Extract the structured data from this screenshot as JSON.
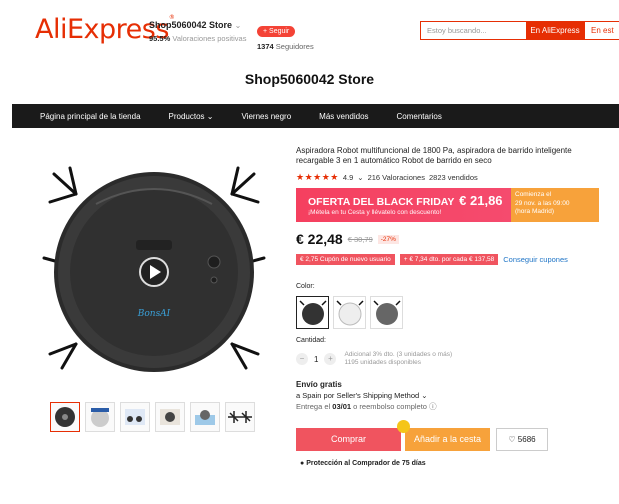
{
  "header": {
    "logo": "AliExpress",
    "shop_name": "Shop5060042 Store",
    "positive_rating": "95.5%",
    "positive_label": "Valoraciones positivas",
    "follow_label": "+ Seguir",
    "followers_count": "1374",
    "followers_label": "Seguidores",
    "search_placeholder": "Estoy buscando...",
    "search_button": "En AliExpress",
    "search_button2": "En est"
  },
  "store_title": "Shop5060042 Store",
  "nav": {
    "items": [
      "Página principal de la tienda",
      "Productos",
      "Viernes negro",
      "Más vendidos",
      "Comentarios"
    ]
  },
  "product": {
    "title": "Aspiradora Robot multifuncional de 1800 Pa, aspiradora de barrido inteligente recargable 3 en 1 automático Robot de barrido en seco",
    "stars": "★★★★★",
    "rating": "4.9",
    "reviews": "216 Valoraciones",
    "sold": "2823 vendidos",
    "black_friday": {
      "label": "OFERTA DEL BLACK FRIDAY",
      "price": "€ 21,86",
      "subtitle": "¡Métela en tu Cesta y llévatelo con descuento!",
      "start_line1": "Comienza el",
      "start_line2": "29 nov. a las 09:00",
      "start_line3": "(hora Madrid)"
    },
    "price": "€ 22,48",
    "old_price": "€ 30,79",
    "discount": "-27%",
    "coupons": [
      "€ 2,75 Cupón de nuevo usuario",
      "+ € 7,34 dto. por cada € 137,58"
    ],
    "coupon_link": "Conseguir cupones",
    "color_label": "Color:",
    "quantity_label": "Cantidad:",
    "quantity": "1",
    "qty_note_line1": "Adicional 3% dto. (3 unidades o más)",
    "qty_note_line2": "1195 unidades disponibles",
    "shipping_title": "Envío gratis",
    "shipping_method": "a Spain por Seller's Shipping Method",
    "delivery_prefix": "Entrega el",
    "delivery_date": "03/01",
    "delivery_suffix": "o reembolso completo",
    "buy_label": "Comprar",
    "cart_label": "Añadir a la cesta",
    "wishlist_count": "5686",
    "protection": "Protección al Comprador de 75 días"
  },
  "colors": {
    "accent": "#e62e04",
    "black_friday": "#f5405f",
    "orange": "#f7a23b",
    "link": "#2176c7"
  }
}
